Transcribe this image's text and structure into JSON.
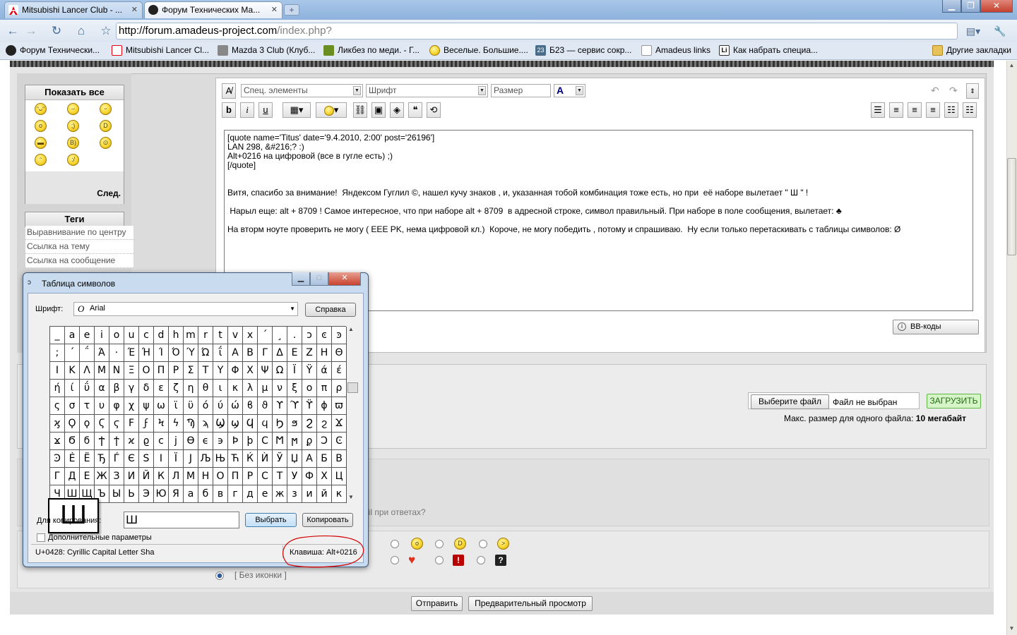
{
  "browser": {
    "tabs": [
      {
        "title": "Mitsubishi Lancer Club - ...",
        "icon": "mitsubishi-icon"
      },
      {
        "title": "Форум Технических Ма...",
        "icon": "amadeus-icon"
      }
    ],
    "url_host": "http://forum.amadeus-project.com",
    "url_rest": "/index.php?",
    "bookmarks": [
      "Форум Технически...",
      "Mitsubishi Lancer Cl...",
      "Mazda 3 Club (Клуб...",
      "Ликбез по меди. - Г...",
      "Веселые. Большие....",
      "Б23 — сервис сокр...",
      "Amadeus links",
      "Как набрать специа..."
    ],
    "other_bookmarks": "Другие закладки"
  },
  "page": {
    "smilies_header": "Показать все",
    "smilies_next": "След.",
    "tags_header": "Теги",
    "tags": [
      "Выравнивание по центру",
      "Ссылка на тему",
      "Ссылка на сообщение"
    ],
    "toolbar": {
      "special": "Спец. элементы",
      "font": "Шрифт",
      "size": "Размер"
    },
    "editor_text": "[quote name='Titus' date='9.4.2010, 2:00' post='26196']\nLAN 298, &#216;? :)\nAlt+0216 на цифровой (все в гугле есть) ;)\n[/quote]\n\n\nВитя, спасибо за внимание!  Яндексом Гуглил ©, нашел кучу знаков , и, указанная тобой комбинация тоже есть, но при  её наборе вылетает \" Ш \" !\n\n Нарыл еще: alt + 8709 ! Самое интересное, что при наборе alt + 8709  в адресной строке, символ правильный. При наборе в поле сообщения, вылетает: ♣\n\nНа вторм ноуте проверить не могу ( EEE PK, нема цифровой кл.)  Короче, не могу победить , потому и спрашиваю.  Ну если только перетаскивать с таблицы символов: Ø",
    "bbcodes": "BB-коды",
    "choose_file": "Выберите файл",
    "no_file": "Файл не выбран",
    "upload": "ЗАГРУЗИТЬ",
    "max_size_label": "Макс. размер для одного файла:",
    "max_size_value": "10 мегабайт",
    "email_reply_fragment": "ail при ответах?",
    "no_icon": "[ Без иконки ]",
    "send": "Отправить",
    "preview": "Предварительный просмотр"
  },
  "charmap": {
    "title": "Таблица символов",
    "font_label": "Шрифт:",
    "font_value": "Arial",
    "help": "Справка",
    "rows": [
      [
        "_",
        "a",
        "e",
        "i",
        "o",
        "u",
        "c",
        "d",
        "h",
        "m",
        "r",
        "t",
        "v",
        "x",
        "´",
        "¸",
        ".",
        "ͻ",
        "ͼ",
        "ͽ"
      ],
      [
        ";",
        "΄",
        "΅",
        "Ά",
        "·",
        "Έ",
        "Ή",
        "Ί",
        "Ό",
        "Ύ",
        "Ώ",
        "ΐ",
        "Α",
        "Β",
        "Γ",
        "Δ",
        "Ε",
        "Ζ",
        "Η",
        "Θ"
      ],
      [
        "Ι",
        "Κ",
        "Λ",
        "Μ",
        "Ν",
        "Ξ",
        "Ο",
        "Π",
        "Ρ",
        "Σ",
        "Τ",
        "Υ",
        "Φ",
        "Χ",
        "Ψ",
        "Ω",
        "Ϊ",
        "Ϋ",
        "ά",
        "έ"
      ],
      [
        "ή",
        "ί",
        "ΰ",
        "α",
        "β",
        "γ",
        "δ",
        "ε",
        "ζ",
        "η",
        "θ",
        "ι",
        "κ",
        "λ",
        "μ",
        "ν",
        "ξ",
        "ο",
        "π",
        "ρ"
      ],
      [
        "ς",
        "σ",
        "τ",
        "υ",
        "φ",
        "χ",
        "ψ",
        "ω",
        "ϊ",
        "ϋ",
        "ό",
        "ύ",
        "ώ",
        "ϐ",
        "ϑ",
        "ϒ",
        "ϓ",
        "ϔ",
        "ϕ",
        "ϖ"
      ],
      [
        "ϗ",
        "Ϙ",
        "ϙ",
        "Ϛ",
        "ϛ",
        "Ϝ",
        "ϝ",
        "Ϟ",
        "ϟ",
        "Ϡ",
        "ϡ",
        "Ϣ",
        "ϣ",
        "Ϥ",
        "ϥ",
        "Ϧ",
        "ϧ",
        "Ϩ",
        "ϩ",
        "Ϫ"
      ],
      [
        "ϫ",
        "Ϭ",
        "ϭ",
        "Ϯ",
        "ϯ",
        "ϰ",
        "ϱ",
        "ϲ",
        "ϳ",
        "ϴ",
        "ϵ",
        "϶",
        "Ϸ",
        "ϸ",
        "Ϲ",
        "Ϻ",
        "ϻ",
        "ϼ",
        "Ͻ",
        "Ͼ"
      ],
      [
        "Ͽ",
        "Ѐ",
        "Ё",
        "Ђ",
        "Ѓ",
        "Є",
        "Ѕ",
        "І",
        "Ї",
        "Ј",
        "Љ",
        "Њ",
        "Ћ",
        "Ќ",
        "Ѝ",
        "Ў",
        "Џ",
        "А",
        "Б",
        "В"
      ],
      [
        "Г",
        "Д",
        "Е",
        "Ж",
        "З",
        "И",
        "Й",
        "К",
        "Л",
        "М",
        "Н",
        "О",
        "П",
        "Р",
        "С",
        "Т",
        "У",
        "Ф",
        "Х",
        "Ц"
      ],
      [
        "Ч",
        "Ш",
        "Щ",
        "Ъ",
        "Ы",
        "Ь",
        "Э",
        "Ю",
        "Я",
        "а",
        "б",
        "в",
        "г",
        "д",
        "е",
        "ж",
        "з",
        "и",
        "й",
        "к"
      ]
    ],
    "selected_char": "Ш",
    "copy_label": "Для копирования:",
    "copy_value": "Ш",
    "select_btn": "Выбрать",
    "copy_btn": "Копировать",
    "advanced": "Дополнительные параметры",
    "status_char": "U+0428: Cyrillic Capital Letter Sha",
    "status_key": "Клавиша: Alt+0216"
  }
}
